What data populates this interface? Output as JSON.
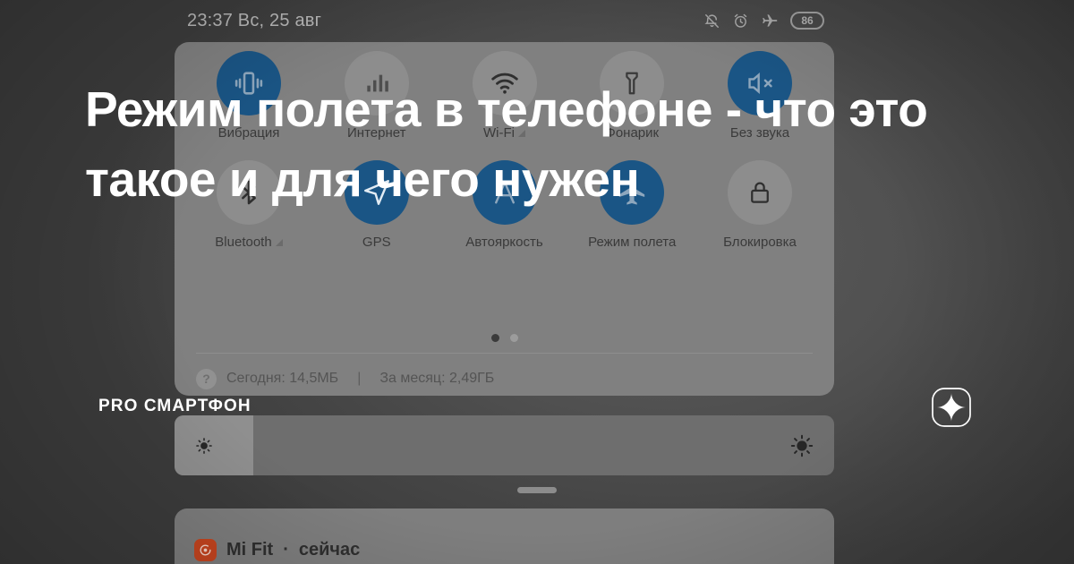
{
  "statusbar": {
    "clock": "23:37 Вс, 25 авг",
    "battery_level": "86",
    "icons": [
      "bell-muted-icon",
      "alarm-clock-icon",
      "airplane-icon",
      "battery-icon"
    ]
  },
  "quick_settings": {
    "rows": [
      [
        {
          "label": "Вибрация",
          "icon": "vibration-icon",
          "active": true,
          "expandable": false
        },
        {
          "label": "Интернет",
          "icon": "mobile-data-icon",
          "active": false,
          "expandable": false
        },
        {
          "label": "Wi-Fi",
          "icon": "wifi-icon",
          "active": false,
          "expandable": true
        },
        {
          "label": "Фонарик",
          "icon": "flashlight-icon",
          "active": false,
          "expandable": false
        },
        {
          "label": "Без звука",
          "icon": "mute-icon",
          "active": true,
          "expandable": false
        }
      ],
      [
        {
          "label": "Bluetooth",
          "icon": "bluetooth-icon",
          "active": false,
          "expandable": true
        },
        {
          "label": "GPS",
          "icon": "location-icon",
          "active": true,
          "expandable": false
        },
        {
          "label": "Автояркость",
          "icon": "auto-brightness-icon",
          "active": true,
          "expandable": false
        },
        {
          "label": "Режим полета",
          "icon": "airplane-mode-icon",
          "active": true,
          "expandable": false
        },
        {
          "label": "Блокировка",
          "icon": "lock-icon",
          "active": false,
          "expandable": false
        }
      ]
    ],
    "pagination": {
      "pages": 2,
      "current": 1
    },
    "data_usage": {
      "help": "?",
      "today": "Сегодня: 14,5МБ",
      "separator": "|",
      "month": "За месяц: 2,49ГБ"
    }
  },
  "brightness": {
    "value_percent": 12,
    "low_icon": "sun-small-icon",
    "high_icon": "sun-large-icon"
  },
  "notification": {
    "app": "Mi Fit",
    "separator": "·",
    "time": "сейчас",
    "icon": "mi-fit-app-icon"
  },
  "overlay": {
    "headline": "Режим полета в телефоне - что это такое и для чего нужен",
    "brand": "PRO СМАРТФОН",
    "logo": "zen-sparkle-logo"
  },
  "colors": {
    "accent_blue": "#1a5585",
    "shade_gray": "#808080",
    "tile_inactive": "#8d8d8d",
    "notif_accent": "#c7451f",
    "background": "#4d4d4d"
  }
}
